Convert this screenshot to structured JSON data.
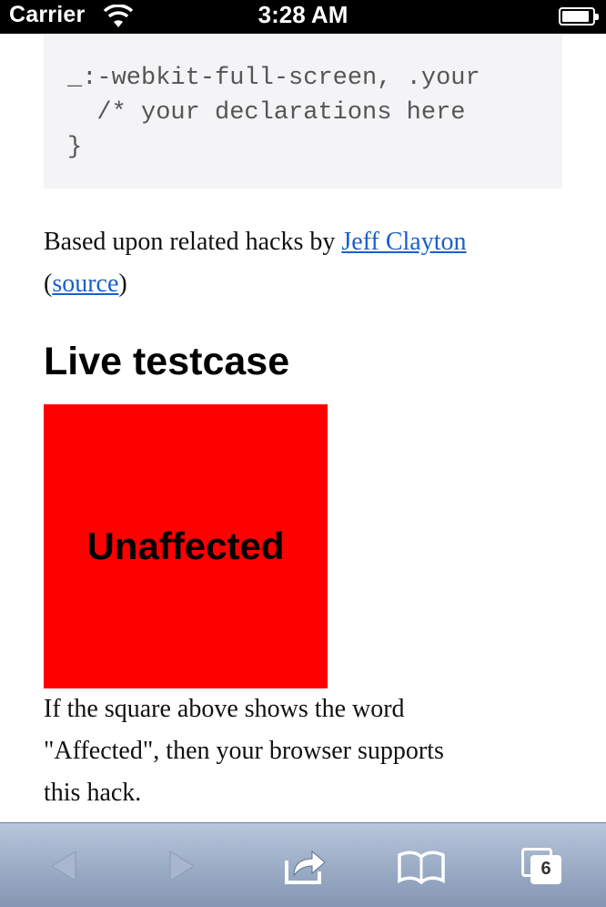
{
  "status_bar": {
    "carrier": "Carrier",
    "time": "3:28 AM",
    "battery_level": 0.9
  },
  "code": {
    "lines": [
      "_:-webkit-full-screen, .your",
      "  /* your declarations here",
      "}"
    ]
  },
  "credit": {
    "prefix": "Based upon related hacks by ",
    "author_link": "Jeff Clayton",
    "open_paren": "(",
    "source_link": "source",
    "close_paren": ")"
  },
  "heading": "Live testcase",
  "testcase": {
    "square_text": "Unaffected",
    "square_color": "#ff0000",
    "result_line1": "If the square above shows the word",
    "result_line2": "\"Affected\", then your browser supports",
    "result_line3": "this hack."
  },
  "toolbar": {
    "buttons": [
      "back-icon",
      "forward-icon",
      "share-icon",
      "bookmarks-icon",
      "tabs-icon"
    ],
    "tabs_count": "6"
  },
  "colors": {
    "link": "#1a5fcc",
    "toolbar": "#9fb0c9"
  }
}
